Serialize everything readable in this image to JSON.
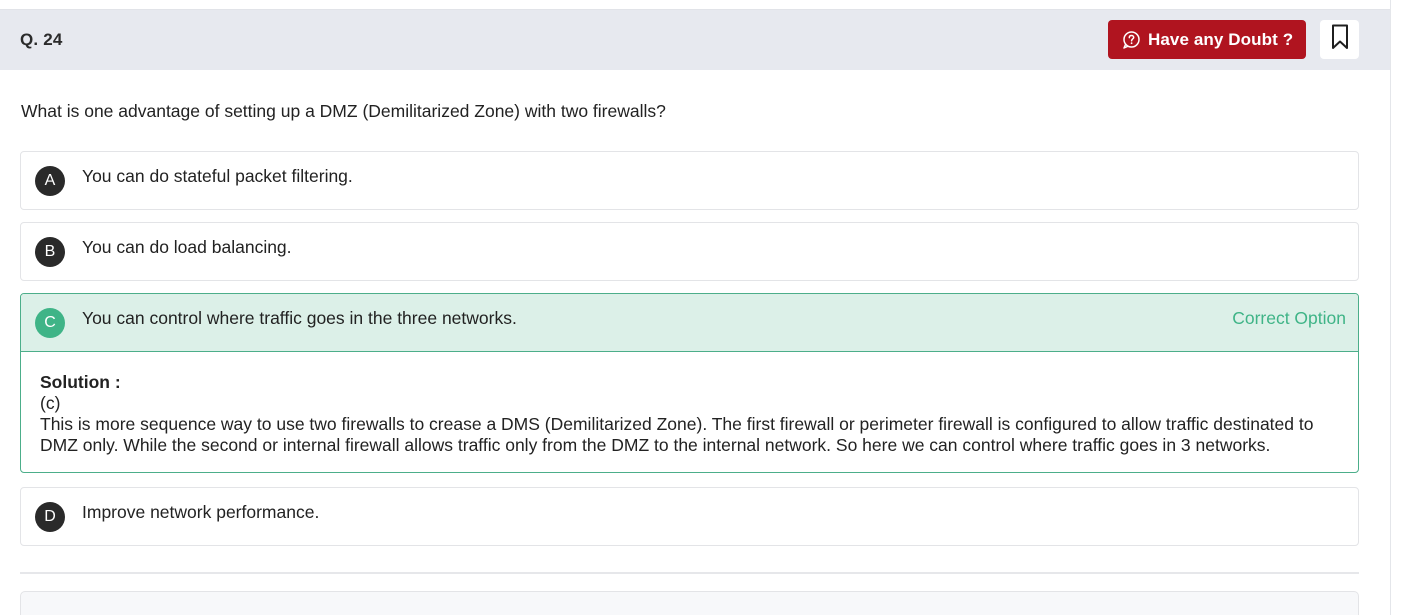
{
  "header": {
    "question_number": "Q. 24",
    "doubt_button_label": "Have any Doubt ?",
    "accent_color": "#b0141f"
  },
  "question": {
    "text": "What is one advantage of setting up a DMZ (Demilitarized Zone) with two firewalls?"
  },
  "options": [
    {
      "letter": "A",
      "text": "You can do stateful packet filtering."
    },
    {
      "letter": "B",
      "text": "You can do load balancing."
    },
    {
      "letter": "C",
      "text": "You can control where traffic goes in the three networks.",
      "status": "Correct Option"
    },
    {
      "letter": "D",
      "text": "Improve network performance."
    }
  ],
  "solution": {
    "title": "Solution :",
    "answer": "(c)",
    "explanation": "This is more sequence way to use two firewalls to crease a DMS (Demilitarized Zone). The first firewall or perimeter firewall is configured to allow traffic destinated to DMZ only. While the second or internal firewall allows traffic only from the DMZ to the internal network. So here we can control where traffic goes in 3 networks."
  },
  "icons": {
    "doubt": "question-bubble-icon",
    "bookmark": "bookmark-icon"
  },
  "colors": {
    "correct": "#3fb487",
    "correct_bg": "#dcf0e8"
  }
}
